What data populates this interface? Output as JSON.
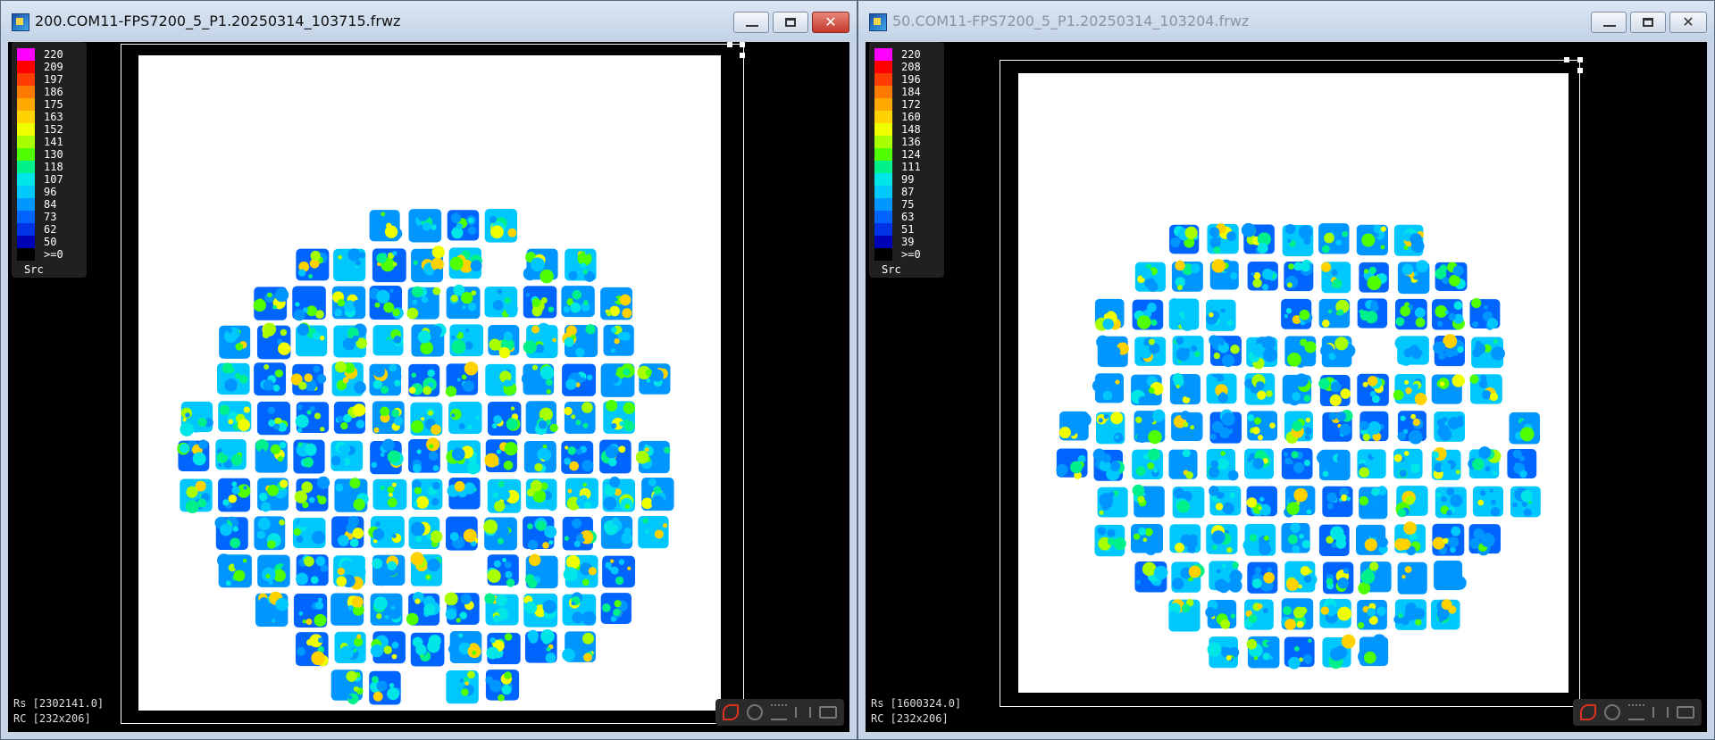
{
  "windows": [
    {
      "title": "200.COM11-FPS7200_5_P1.20250314_103715.frwz",
      "active": true,
      "legend": {
        "labels": [
          "220",
          "209",
          "197",
          "186",
          "175",
          "163",
          "152",
          "141",
          "130",
          "118",
          "107",
          "96",
          "84",
          "73",
          "62",
          "50",
          ">=0"
        ],
        "colors": [
          "#ff00ff",
          "#ff0000",
          "#ff3d00",
          "#ff7a00",
          "#ffa800",
          "#ffd200",
          "#f0ff00",
          "#a8ff00",
          "#50ff00",
          "#00f08c",
          "#00e6e6",
          "#00c8ff",
          "#0096ff",
          "#0064ff",
          "#0032e6",
          "#0000b4",
          "#000000"
        ],
        "source_label": "Src"
      },
      "status": {
        "rs": "Rs [2302141.0]",
        "rc": "RC [232x206]"
      },
      "toolbar": {
        "icons": [
          "measure-icon",
          "gauge-icon",
          "wave-icon",
          "fit-icon",
          "rect-icon"
        ]
      }
    },
    {
      "title": "50.COM11-FPS7200_5_P1.20250314_103204.frwz",
      "active": false,
      "legend": {
        "labels": [
          "220",
          "208",
          "196",
          "184",
          "172",
          "160",
          "148",
          "136",
          "124",
          "111",
          "99",
          "87",
          "75",
          "63",
          "51",
          "39",
          ">=0"
        ],
        "colors": [
          "#ff00ff",
          "#ff0000",
          "#ff3d00",
          "#ff7a00",
          "#ffa800",
          "#ffd200",
          "#f0ff00",
          "#a8ff00",
          "#50ff00",
          "#00f08c",
          "#00e6e6",
          "#00c8ff",
          "#0096ff",
          "#0064ff",
          "#0032e6",
          "#0000b4",
          "#000000"
        ],
        "source_label": "Src"
      },
      "status": {
        "rs": "Rs [1600324.0]",
        "rc": "RC [232x206]"
      },
      "toolbar": {
        "icons": [
          "measure-icon",
          "gauge-icon",
          "wave-icon",
          "fit-icon",
          "rect-icon"
        ]
      }
    }
  ]
}
